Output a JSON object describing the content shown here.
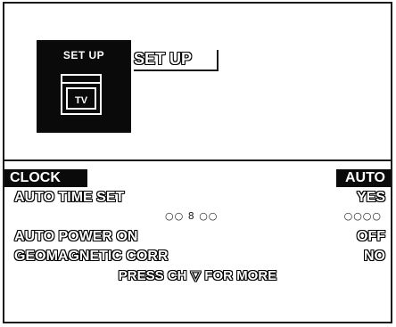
{
  "header": {
    "icon_label": "SET UP",
    "icon_screen_label": "TV",
    "title": "SET UP"
  },
  "menu": {
    "items": [
      {
        "label": "CLOCK",
        "value": "AUTO"
      },
      {
        "label": "AUTO TIME SET",
        "value": "YES"
      },
      {
        "label": "",
        "value": ""
      },
      {
        "label": "AUTO POWER ON",
        "value": "OFF"
      },
      {
        "label": "GEOMAGNETIC CORR",
        "value": "NO"
      }
    ],
    "time_readout": "○○ 8 ○○",
    "date_readout": "○○○○",
    "footer": "PRESS CH ▽ FOR MORE"
  }
}
